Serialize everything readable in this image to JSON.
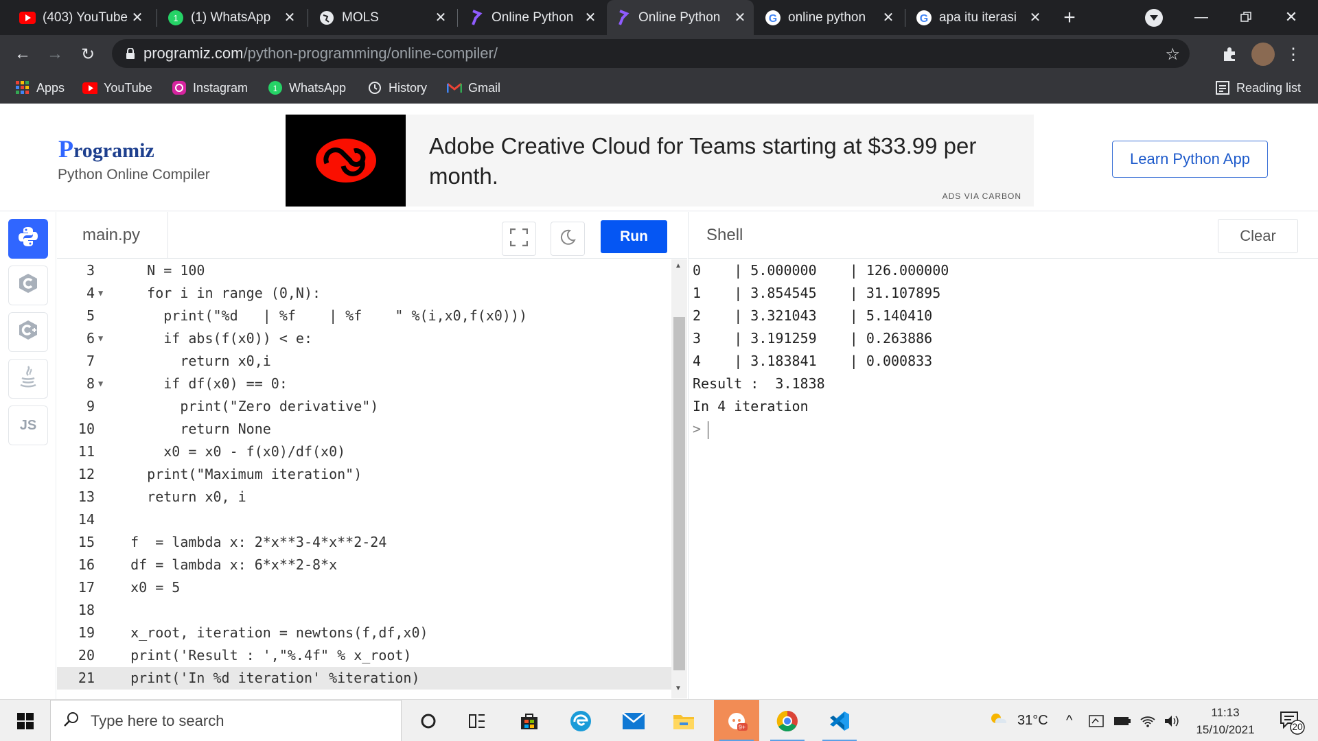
{
  "browser": {
    "tabs": [
      {
        "title": "(403) YouTube",
        "icon": "youtube-icon",
        "active": false
      },
      {
        "title": "(1) WhatsApp",
        "icon": "whatsapp-icon",
        "active": false
      },
      {
        "title": "MOLS",
        "icon": "globe-icon",
        "active": false
      },
      {
        "title": "Online Python",
        "icon": "programiz-icon",
        "active": false
      },
      {
        "title": "Online Python",
        "icon": "programiz-icon",
        "active": true
      },
      {
        "title": "online python",
        "icon": "google-icon",
        "active": false
      },
      {
        "title": "apa itu iterasi",
        "icon": "google-icon",
        "active": false
      }
    ],
    "url_host": "programiz.com",
    "url_path": "/python-programming/online-compiler/",
    "bookmarks": [
      "Apps",
      "YouTube",
      "Instagram",
      "WhatsApp",
      "History",
      "Gmail"
    ],
    "reading_list": "Reading list"
  },
  "site": {
    "logo_p": "P",
    "logo_rest": "rogramiz",
    "subtitle": "Python Online Compiler",
    "ad_text": "Adobe Creative Cloud for Teams starting at $33.99 per month.",
    "ad_by": "ADS VIA CARBON",
    "learn_button": "Learn Python App"
  },
  "sidebar": [
    "python",
    "c",
    "cpp",
    "java",
    "JS"
  ],
  "editor": {
    "filename": "main.py",
    "run_label": "Run",
    "lines": [
      {
        "n": "3",
        "fold": false,
        "text": "    N = 100"
      },
      {
        "n": "4",
        "fold": true,
        "text": "    for i in range (0,N):"
      },
      {
        "n": "5",
        "fold": false,
        "text": "      print(\"%d   | %f    | %f    \" %(i,x0,f(x0)))"
      },
      {
        "n": "6",
        "fold": true,
        "text": "      if abs(f(x0)) < e:"
      },
      {
        "n": "7",
        "fold": false,
        "text": "        return x0,i"
      },
      {
        "n": "8",
        "fold": true,
        "text": "      if df(x0) == 0:"
      },
      {
        "n": "9",
        "fold": false,
        "text": "        print(\"Zero derivative\")"
      },
      {
        "n": "10",
        "fold": false,
        "text": "        return None"
      },
      {
        "n": "11",
        "fold": false,
        "text": "      x0 = x0 - f(x0)/df(x0)"
      },
      {
        "n": "12",
        "fold": false,
        "text": "    print(\"Maximum iteration\")"
      },
      {
        "n": "13",
        "fold": false,
        "text": "    return x0, i"
      },
      {
        "n": "14",
        "fold": false,
        "text": ""
      },
      {
        "n": "15",
        "fold": false,
        "text": "  f  = lambda x: 2*x**3-4*x**2-24"
      },
      {
        "n": "16",
        "fold": false,
        "text": "  df = lambda x: 6*x**2-8*x"
      },
      {
        "n": "17",
        "fold": false,
        "text": "  x0 = 5"
      },
      {
        "n": "18",
        "fold": false,
        "text": ""
      },
      {
        "n": "19",
        "fold": false,
        "text": "  x_root, iteration = newtons(f,df,x0)"
      },
      {
        "n": "20",
        "fold": false,
        "text": "  print('Result : ',\"%.4f\" % x_root)"
      },
      {
        "n": "21",
        "fold": false,
        "text": "  print('In %d iteration' %iteration)"
      }
    ]
  },
  "shell": {
    "title": "Shell",
    "clear_label": "Clear",
    "lines": [
      "0    | 5.000000    | 126.000000",
      "1    | 3.854545    | 31.107895",
      "2    | 3.321043    | 5.140410",
      "3    | 3.191259    | 0.263886",
      "4    | 3.183841    | 0.000833",
      "Result :  3.1838",
      "In 4 iteration"
    ],
    "prompt": ">"
  },
  "taskbar": {
    "search_placeholder": "Type here to search",
    "temperature": "31°C",
    "time": "11:13",
    "date": "15/10/2021",
    "notifications": "20"
  },
  "colors": {
    "accent": "#0556f3",
    "brand": "#3066ff",
    "chrome": "#202124"
  }
}
